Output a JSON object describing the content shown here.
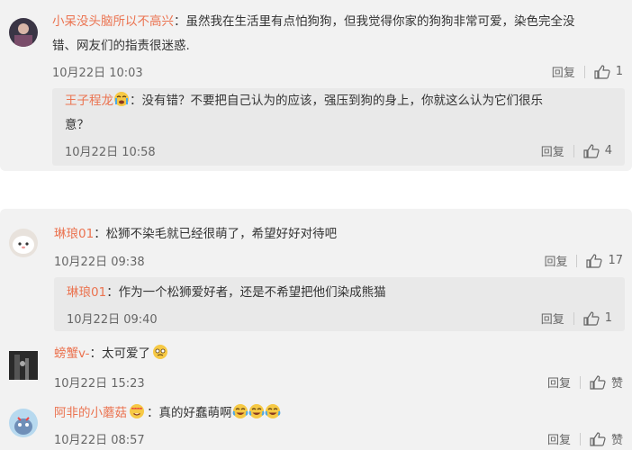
{
  "card1": {
    "comment": {
      "username": "小呆没头脑所以不高兴",
      "text_line1": "：虽然我在生活里有点怕狗狗，但我觉得你家的狗狗非常可爱，染色完全没",
      "text_line2": "错、网友们的指责很迷惑.",
      "date": "10月22日 10:03",
      "reply_label": "回复",
      "likes": "1"
    },
    "reply": {
      "username": "王子程龙",
      "text_line1": "：没有错？不要把自己认为的应该，强压到狗的身上，你就这么认为它们很乐",
      "text_line2": "意？",
      "date": "10月22日 10:58",
      "reply_label": "回复",
      "likes": "4"
    }
  },
  "card2": {
    "comment1": {
      "username": "琳琅01",
      "text": "：松狮不染毛就已经很萌了，希望好好对待吧",
      "date": "10月22日 09:38",
      "reply_label": "回复",
      "likes": "17"
    },
    "reply": {
      "username": "琳琅01",
      "text": "：作为一个松狮爱好者，还是不希望把他们染成熊猫",
      "date": "10月22日 09:40",
      "reply_label": "回复",
      "likes": "1"
    },
    "comment2": {
      "username": "螃蟹v-",
      "text": "：太可爱了",
      "date": "10月22日 15:23",
      "reply_label": "回复",
      "likes": "赞"
    },
    "comment3": {
      "username": "阿非的小蘑菇",
      "text": "：真的好蠢萌啊",
      "date": "10月22日 08:57",
      "reply_label": "回复",
      "likes": "赞"
    }
  },
  "colors": {
    "username": "#eb7350",
    "card_bg": "#f2f2f2",
    "reply_bg": "#e9e9e9"
  }
}
